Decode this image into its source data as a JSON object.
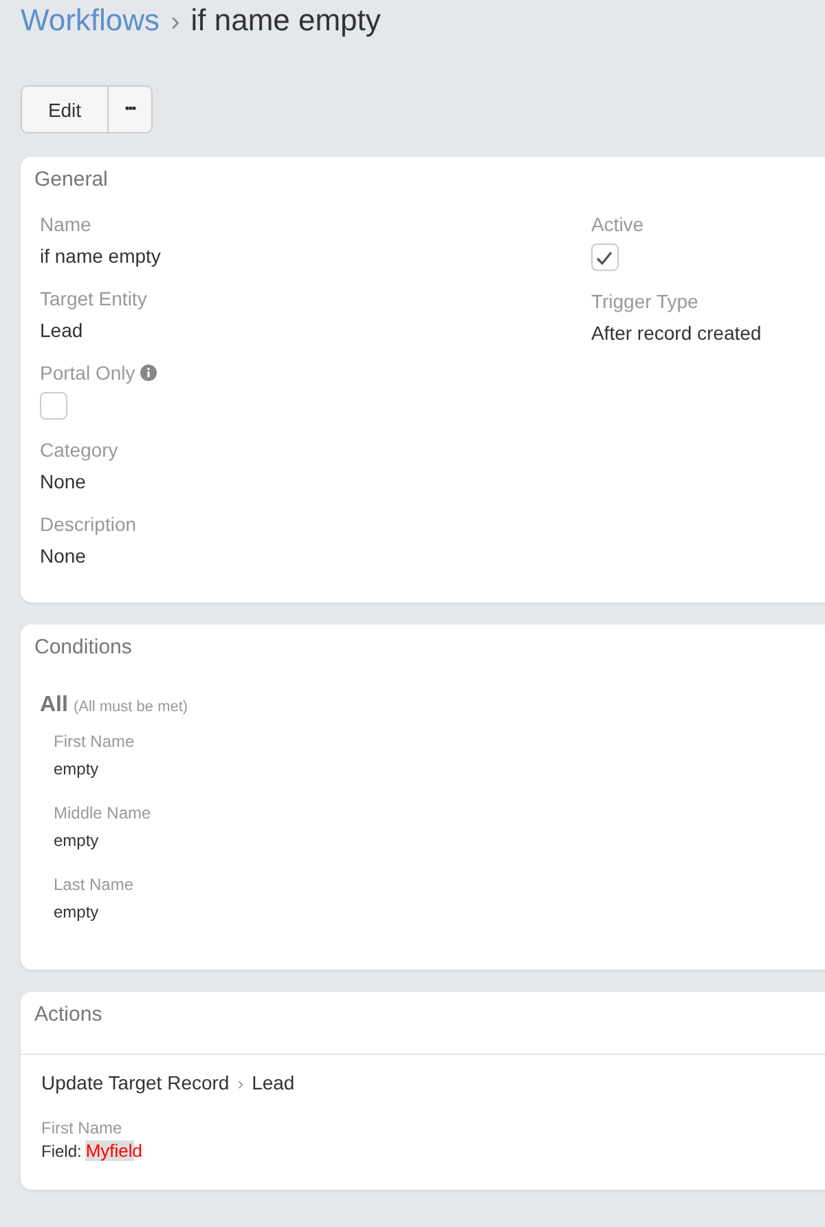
{
  "breadcrumb": {
    "parent": "Workflows",
    "separator": "›",
    "current": "if name empty"
  },
  "buttons": [
    {
      "kind": "text",
      "label": "Edit"
    },
    {
      "kind": "more",
      "label": "•••"
    }
  ],
  "general": {
    "title": "General",
    "left_fields": [
      {
        "kind": "text",
        "label": "Name",
        "value": "if name empty"
      },
      {
        "kind": "text",
        "label": "Target Entity",
        "value": "Lead"
      },
      {
        "kind": "checkbox",
        "label": "Portal Only",
        "info": true,
        "checked": false
      },
      {
        "kind": "text",
        "label": "Category",
        "value": "None"
      },
      {
        "kind": "text",
        "label": "Description",
        "value": "None"
      }
    ],
    "right_fields": [
      {
        "kind": "checkbox",
        "label": "Active",
        "info": false,
        "checked": true
      },
      {
        "kind": "text",
        "label": "Trigger Type",
        "value": "After record created"
      }
    ]
  },
  "conditions": {
    "title": "Conditions",
    "group": "All",
    "group_note": "(All must be met)",
    "items": [
      {
        "field": "First Name",
        "value": "empty"
      },
      {
        "field": "Middle Name",
        "value": "empty"
      },
      {
        "field": "Last Name",
        "value": "empty"
      }
    ]
  },
  "actions": {
    "title": "Actions",
    "items": [
      {
        "type": "Update Target Record",
        "separator": "›",
        "entity": "Lead",
        "field": "First Name",
        "value_label": "Field:",
        "value": "Myfield"
      }
    ]
  }
}
